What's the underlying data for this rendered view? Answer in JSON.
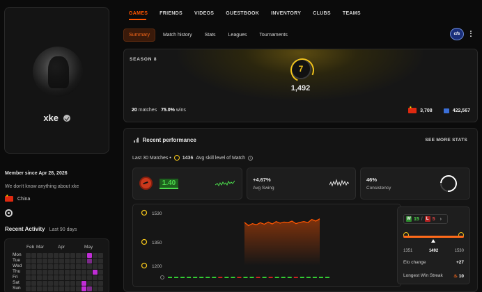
{
  "profile": {
    "username": "xke",
    "member_since": "Member since Apr 28, 2026",
    "bio": "We don't know anything about xke",
    "country": "China"
  },
  "activity": {
    "title": "Recent Activity",
    "subtitle": "Last 90 days",
    "months": [
      "Feb",
      "Mar",
      "Apr",
      "May"
    ],
    "days": [
      "Mon",
      "Tue",
      "Wed",
      "Thu",
      "Fri",
      "Sat",
      "Sun"
    ]
  },
  "nav": {
    "main": [
      "GAMES",
      "FRIENDS",
      "VIDEOS",
      "GUESTBOOK",
      "INVENTORY",
      "CLUBS",
      "TEAMS"
    ],
    "sub": [
      "Summary",
      "Match history",
      "Stats",
      "Leagues",
      "Tournaments"
    ],
    "team_logo": "cfs"
  },
  "season": {
    "label": "SEASON 8",
    "level": "7",
    "elo": "1,492",
    "matches_value": "20",
    "matches_label": "matches",
    "winrate_value": "75.0%",
    "winrate_label": "wins",
    "country_rank": "3,708",
    "global_rank": "422,567"
  },
  "performance": {
    "title": "Recent performance",
    "see_more": "SEE MORE STATS",
    "last_matches": "Last 30 Matches •",
    "avg_level_value": "1436",
    "avg_level_label": "Avg skill level of Match",
    "kd_value": "1.40",
    "swing_value": "+4.67%",
    "swing_label": "Avg Swing",
    "consistency_value": "46%",
    "consistency_label": "Consistency",
    "y_ticks": [
      "1530",
      "1350",
      "1200"
    ],
    "wins": "15",
    "losses": "5",
    "range_min": "1351",
    "range_current": "1492",
    "range_max": "1530",
    "elo_change_label": "Elo change",
    "elo_change_value": "+27",
    "streak_label": "Longest Win Streak",
    "streak_value": "10"
  },
  "chart_data": {
    "type": "line",
    "y": [
      1470,
      1450,
      1462,
      1455,
      1468,
      1458,
      1472,
      1460,
      1475,
      1465,
      1472,
      1468,
      1478,
      1462,
      1470,
      1475,
      1468,
      1488,
      1478,
      1492
    ],
    "results": [
      "W",
      "W",
      "W",
      "W",
      "W",
      "W",
      "W",
      "W",
      "L",
      "W",
      "W",
      "L",
      "W",
      "W",
      "L",
      "W",
      "L",
      "W",
      "W",
      "W",
      "L",
      "W",
      "W",
      "W",
      "W",
      "W"
    ],
    "ylim": [
      1200,
      1530
    ],
    "color": "#ff5500"
  },
  "colors": {
    "accent": "#ff5500",
    "win": "#33cc33",
    "loss": "#cc2222",
    "level": "#f2c41b",
    "activity": "#c02dd6"
  }
}
